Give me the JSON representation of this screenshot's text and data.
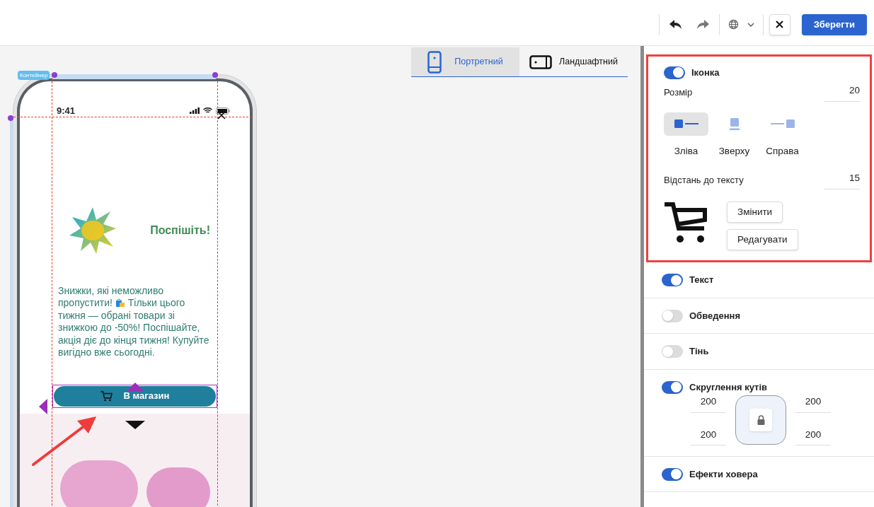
{
  "toolbar": {
    "save_button": "Зберегти"
  },
  "canvas": {
    "container_label": "Контейнер",
    "orientation_tabs": [
      {
        "label": "Портретний",
        "kind": "portrait",
        "selected": true
      },
      {
        "label": "Ландшафтний",
        "kind": "landscape",
        "selected": false
      }
    ]
  },
  "phone": {
    "time": "9:41",
    "heading": "Поспішіть!",
    "paragraph": [
      "Знижки, які неможливо пропустити!",
      "Тільки цього тижня — обрані товари зі знижкою до -50%! Поспішайте, акція діє до кінця тижня! Купуйте вигідно вже сьогодні."
    ],
    "button": "В магазин"
  },
  "icon_section": {
    "title": "Іконка",
    "on": true,
    "size_label": "Розмір",
    "size": "20",
    "positions": [
      {
        "label": "Зліва",
        "kind": "left",
        "selected": true
      },
      {
        "label": "Зверху",
        "kind": "top",
        "selected": false
      },
      {
        "label": "Справа",
        "kind": "right",
        "selected": false
      }
    ],
    "distance_label": "Відстань до тексту",
    "distance": "15",
    "buttons": [
      "Змінити",
      "Редагувати"
    ]
  },
  "sections": [
    {
      "title": "Текст",
      "on": true
    },
    {
      "title": "Обведення",
      "on": false
    },
    {
      "title": "Тінь",
      "on": false
    },
    {
      "title": "Скруглення кутів",
      "on": true,
      "kind": "radius",
      "radii": [
        "200",
        "200",
        "200",
        "200"
      ]
    },
    {
      "title": "Ефекти ховера",
      "on": true
    }
  ]
}
